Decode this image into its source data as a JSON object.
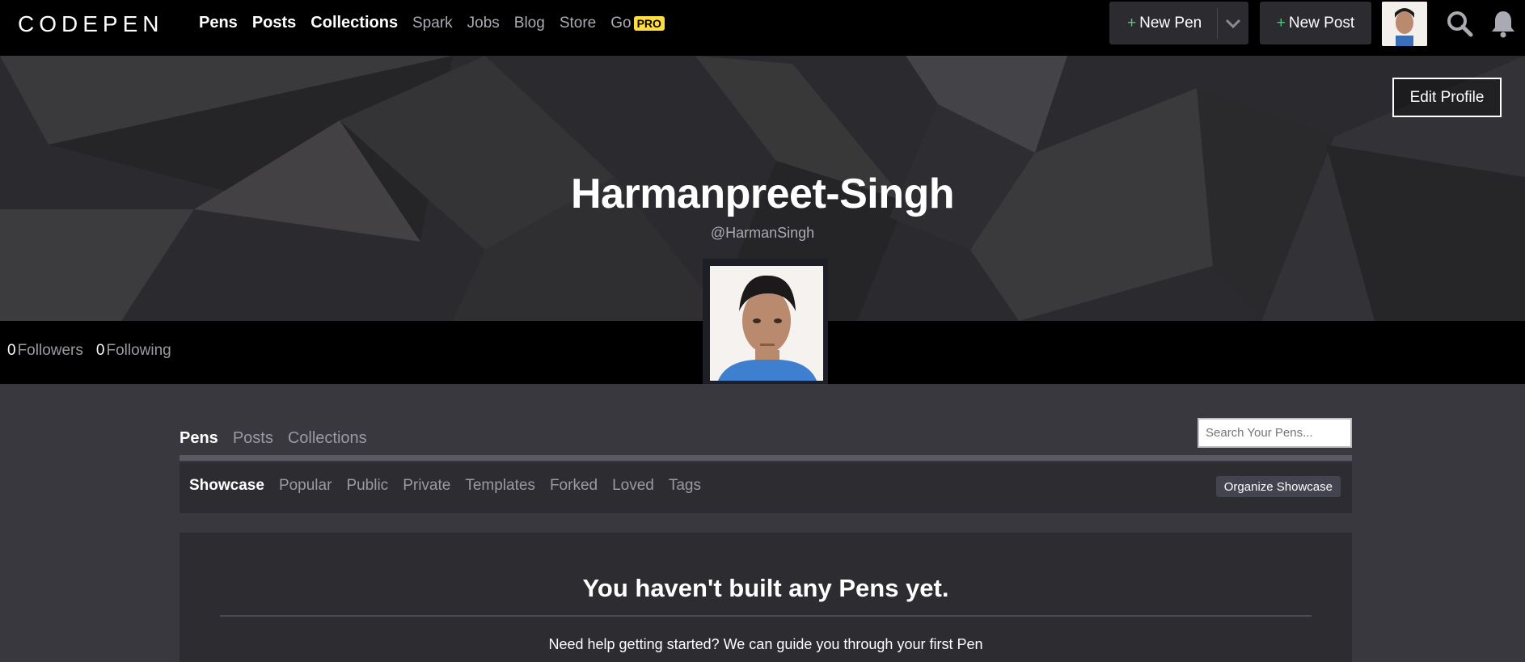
{
  "brand": {
    "logo_text": "CODEPEN"
  },
  "main_nav": [
    "Pens",
    "Posts",
    "Collections"
  ],
  "sub_nav": [
    "Spark",
    "Jobs",
    "Blog",
    "Store"
  ],
  "go_item": {
    "label": "Go",
    "badge": "PRO"
  },
  "header_buttons": {
    "new_pen": "New Pen",
    "new_post": "New Post"
  },
  "profile": {
    "display_name": "Harmanpreet-Singh",
    "username": "@HarmanSingh",
    "edit_label": "Edit Profile",
    "followers_count": "0",
    "followers_label": "Followers",
    "following_count": "0",
    "following_label": "Following"
  },
  "tabs": [
    {
      "label": "Pens",
      "active": true
    },
    {
      "label": "Posts",
      "active": false
    },
    {
      "label": "Collections",
      "active": false
    }
  ],
  "search": {
    "placeholder": "Search Your Pens..."
  },
  "sub_tabs": [
    "Showcase",
    "Popular",
    "Public",
    "Private",
    "Templates",
    "Forked",
    "Loved",
    "Tags"
  ],
  "organize_label": "Organize Showcase",
  "empty_state": {
    "title": "You haven't built any Pens yet.",
    "help": "Need help getting started? We can guide you through your first Pen"
  },
  "colors": {
    "accent_green": "#47cf73",
    "pro_badge": "#ffdd40",
    "panel": "#2c2c31",
    "page_bg": "#38383e"
  }
}
